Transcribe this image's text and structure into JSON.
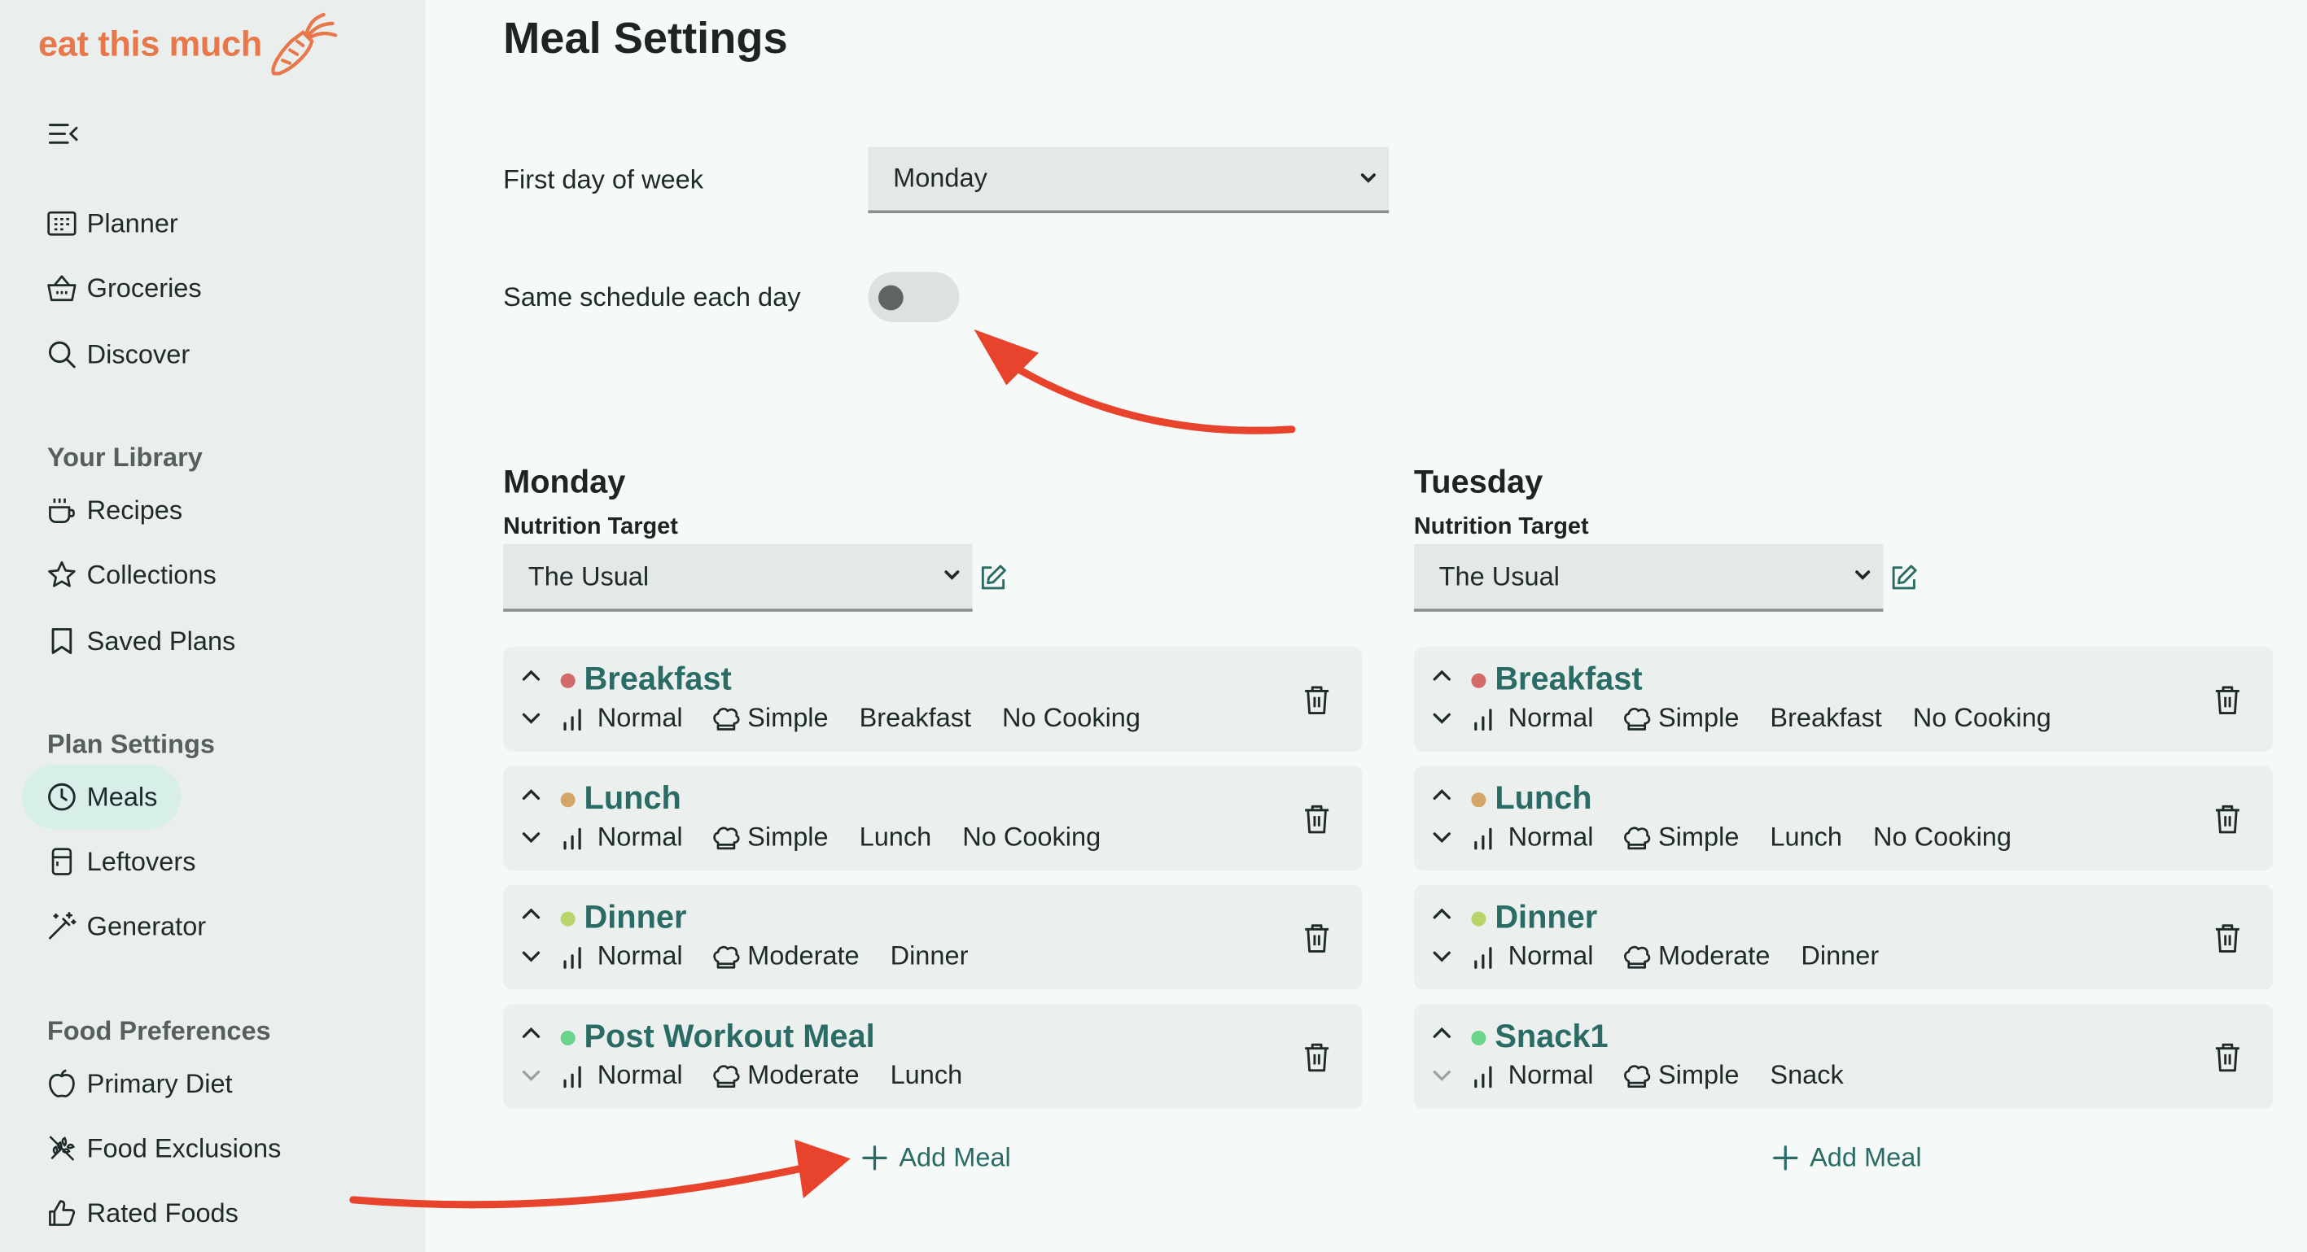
{
  "brand": {
    "logo_text": "eat this much",
    "accent": "#e8784c"
  },
  "sidebar": {
    "nav": [
      {
        "label": "Planner",
        "icon": "calendar-icon"
      },
      {
        "label": "Groceries",
        "icon": "basket-icon"
      },
      {
        "label": "Discover",
        "icon": "search-icon"
      }
    ],
    "library_title": "Your Library",
    "library": [
      {
        "label": "Recipes",
        "icon": "cup-icon"
      },
      {
        "label": "Collections",
        "icon": "star-icon"
      },
      {
        "label": "Saved Plans",
        "icon": "bookmark-icon"
      }
    ],
    "plan_settings_title": "Plan Settings",
    "plan_settings": [
      {
        "label": "Meals",
        "icon": "clock-icon",
        "active": true
      },
      {
        "label": "Leftovers",
        "icon": "container-icon"
      },
      {
        "label": "Generator",
        "icon": "magic-wand-icon"
      }
    ],
    "food_prefs_title": "Food Preferences",
    "food_prefs": [
      {
        "label": "Primary Diet",
        "icon": "apple-icon"
      },
      {
        "label": "Food Exclusions",
        "icon": "wheat-off-icon"
      },
      {
        "label": "Rated Foods",
        "icon": "thumbs-up-icon"
      }
    ]
  },
  "main": {
    "title": "Meal Settings",
    "first_day_label": "First day of week",
    "first_day_value": "Monday",
    "same_schedule_label": "Same schedule each day",
    "same_schedule_on": false,
    "nutrition_target_label": "Nutrition Target",
    "add_meal_label": "Add Meal",
    "days": [
      {
        "name": "Monday",
        "target": "The Usual",
        "meals": [
          {
            "name": "Breakfast",
            "dot": "#d46a6a",
            "size": "Normal",
            "complexity": "Simple",
            "type": "Breakfast",
            "extra": "No Cooking"
          },
          {
            "name": "Lunch",
            "dot": "#d4a66a",
            "size": "Normal",
            "complexity": "Simple",
            "type": "Lunch",
            "extra": "No Cooking"
          },
          {
            "name": "Dinner",
            "dot": "#b8d46a",
            "size": "Normal",
            "complexity": "Moderate",
            "type": "Dinner",
            "extra": ""
          },
          {
            "name": "Post Workout Meal",
            "dot": "#6ad48a",
            "size": "Normal",
            "complexity": "Moderate",
            "type": "Lunch",
            "extra": ""
          }
        ]
      },
      {
        "name": "Tuesday",
        "target": "The Usual",
        "meals": [
          {
            "name": "Breakfast",
            "dot": "#d46a6a",
            "size": "Normal",
            "complexity": "Simple",
            "type": "Breakfast",
            "extra": "No Cooking"
          },
          {
            "name": "Lunch",
            "dot": "#d4a66a",
            "size": "Normal",
            "complexity": "Simple",
            "type": "Lunch",
            "extra": "No Cooking"
          },
          {
            "name": "Dinner",
            "dot": "#b8d46a",
            "size": "Normal",
            "complexity": "Moderate",
            "type": "Dinner",
            "extra": ""
          },
          {
            "name": "Snack1",
            "dot": "#6ad48a",
            "size": "Normal",
            "complexity": "Simple",
            "type": "Snack",
            "extra": ""
          }
        ]
      }
    ]
  },
  "annotation_color": "#e8432c"
}
